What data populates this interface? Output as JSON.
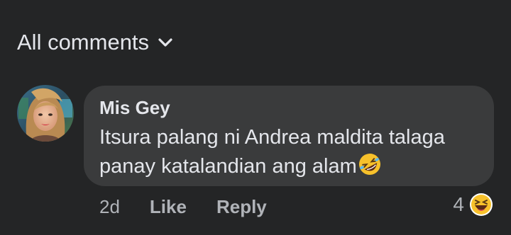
{
  "header": {
    "filter_label": "All comments",
    "filter_icon": "chevron-down-icon"
  },
  "comment": {
    "author": "Mis Gey",
    "text": "Itsura palang ni Andrea maldita talaga panay katalandian ang alam",
    "inline_emoji": "rolling-on-floor-laughing-emoji",
    "time": "2d",
    "like_label": "Like",
    "reply_label": "Reply",
    "reaction_count": "4",
    "reaction_emoji": "laughing-emoji"
  },
  "colors": {
    "background": "#242526",
    "bubble": "#3a3b3c",
    "primary_text": "#e4e6eb",
    "secondary_text": "#b0b3b8",
    "emoji_yellow": "#f7c12b"
  }
}
